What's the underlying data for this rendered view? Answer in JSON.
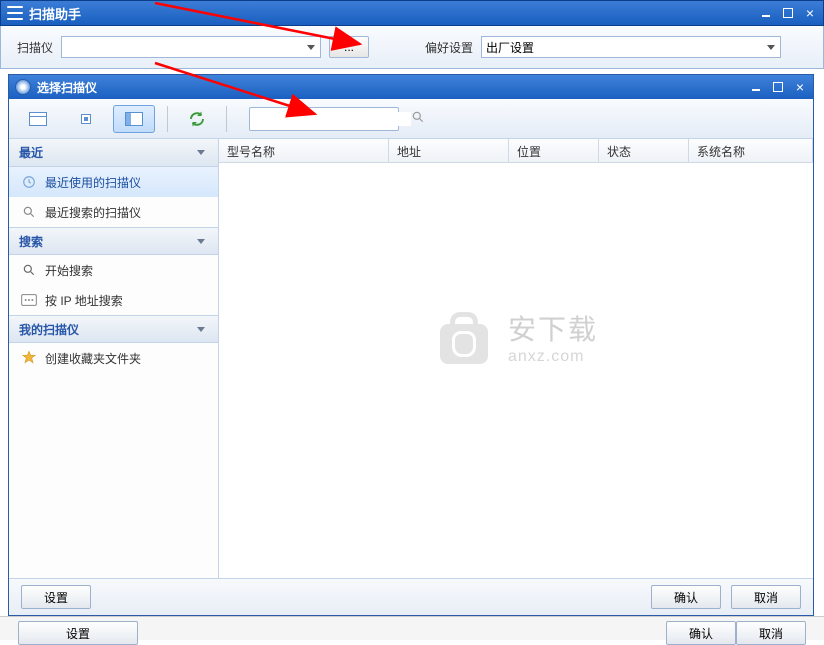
{
  "main": {
    "title": "扫描助手",
    "toolbar": {
      "scanner_label": "扫描仪",
      "browse_label": "...",
      "preset_label": "偏好设置",
      "preset_value": "出厂设置"
    }
  },
  "dialog": {
    "title": "选择扫描仪",
    "search_placeholder": "",
    "sidebar": {
      "groups": [
        {
          "label": "最近",
          "items": [
            {
              "label": "最近使用的扫描仪",
              "icon": "clock-icon",
              "selected": true
            },
            {
              "label": "最近搜索的扫描仪",
              "icon": "search-doc-icon",
              "selected": false
            }
          ]
        },
        {
          "label": "搜索",
          "items": [
            {
              "label": "开始搜索",
              "icon": "magnifier-icon",
              "selected": false
            },
            {
              "label": "按 IP 地址搜索",
              "icon": "ip-icon",
              "selected": false
            }
          ]
        },
        {
          "label": "我的扫描仪",
          "items": [
            {
              "label": "创建收藏夹文件夹",
              "icon": "star-folder-icon",
              "selected": false
            }
          ]
        }
      ]
    },
    "columns": [
      "型号名称",
      "地址",
      "位置",
      "状态",
      "系统名称"
    ],
    "footer": {
      "settings": "设置",
      "ok": "确认",
      "cancel": "取消"
    }
  },
  "watermark": {
    "cn": "安下载",
    "en": "anxz.com"
  },
  "bottom": {
    "settings": "设置",
    "ok": "确认",
    "cancel": "取消"
  }
}
